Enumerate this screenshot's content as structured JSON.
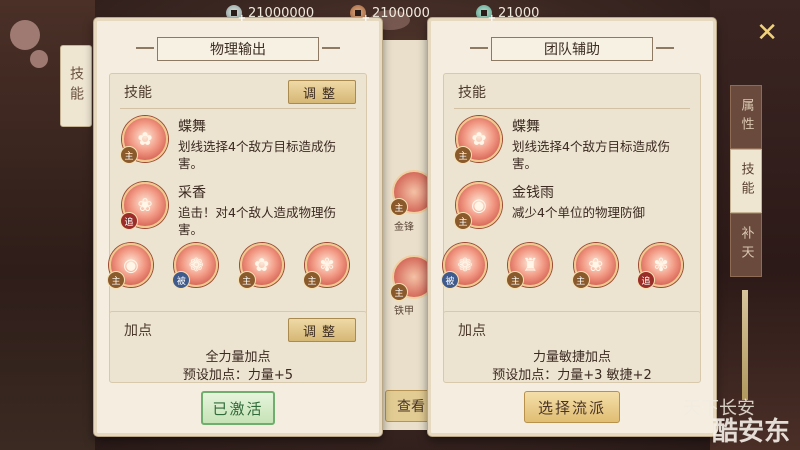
{
  "currencies": [
    {
      "icon": "silver-coin-icon",
      "value": "21000000"
    },
    {
      "icon": "bronze-coin-icon",
      "value": "2100000"
    },
    {
      "icon": "jade-coin-icon",
      "value": "21000"
    }
  ],
  "left_tab": "技能",
  "right_tabs": [
    "属性",
    "技能",
    "补天"
  ],
  "middle_panel": {
    "label_1": "金锋",
    "label_2": "铁甲",
    "badge": "主",
    "view_button": "查看"
  },
  "cards": [
    {
      "title": "物理输出",
      "skill_section_label": "技能",
      "adjust_label": "调整",
      "skills": [
        {
          "name": "蝶舞",
          "badge": "主",
          "desc": "划线选择4个敌方目标造成伤害。"
        },
        {
          "name": "采香",
          "badge": "追",
          "desc": "追击！对4个敌人造成物理伤害。"
        }
      ],
      "small_skills": [
        {
          "badge": "主",
          "icon": "coins-skill-icon"
        },
        {
          "badge": "被",
          "icon": "lotus-skill-icon"
        },
        {
          "badge": "主",
          "icon": "butterfly-skill-icon"
        },
        {
          "badge": "主",
          "icon": "butterfly-skill-icon"
        }
      ],
      "points_label": "加点",
      "points_adjust_label": "调整",
      "points_name": "全力量加点",
      "points_preset": "预设加点：力量+5",
      "action_label": "已激活"
    },
    {
      "title": "团队辅助",
      "skill_section_label": "技能",
      "skills": [
        {
          "name": "蝶舞",
          "badge": "主",
          "desc": "划线选择4个敌方目标造成伤害。"
        },
        {
          "name": "金钱雨",
          "badge": "主",
          "desc": "减少4个单位的物理防御"
        }
      ],
      "small_skills": [
        {
          "badge": "被",
          "icon": "lotus-skill-icon"
        },
        {
          "badge": "主",
          "icon": "figure-skill-icon"
        },
        {
          "badge": "主",
          "icon": "flower-skill-icon"
        },
        {
          "badge": "追",
          "icon": "butterfly-skill-icon"
        }
      ],
      "points_label": "加点",
      "points_name": "力量敏捷加点",
      "points_preset": "预设加点：力量+3 敏捷+2",
      "action_label": "选择流派"
    }
  ],
  "watermark": "酷安东",
  "logo_text": "天下长安"
}
